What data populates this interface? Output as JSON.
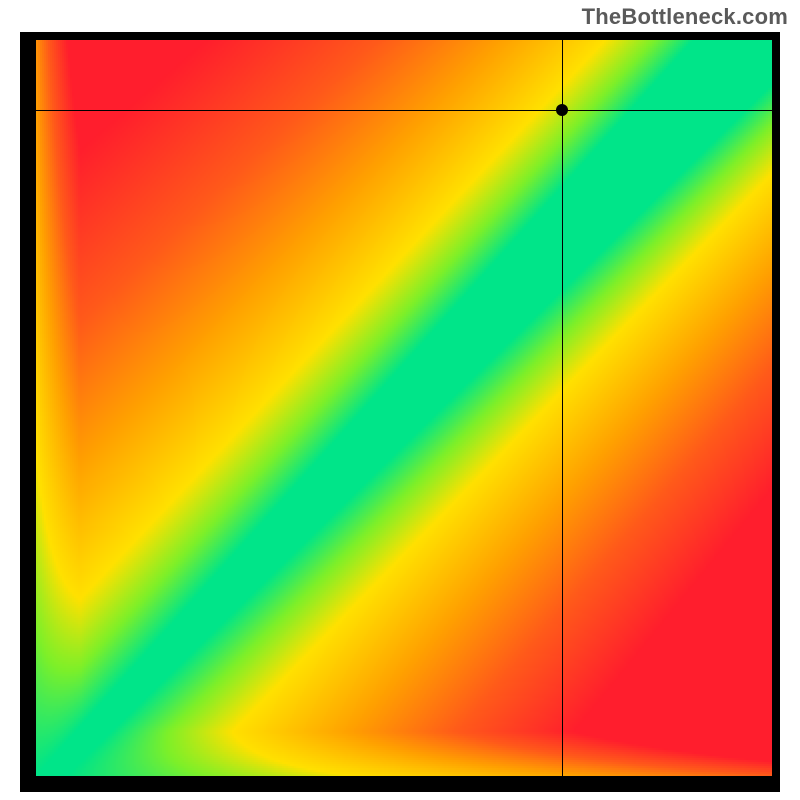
{
  "watermark": "TheBottleneck.com",
  "chart_data": {
    "type": "heatmap",
    "title": "",
    "xlabel": "",
    "ylabel": "",
    "xlim": [
      0,
      1
    ],
    "ylim": [
      0,
      1
    ],
    "grid": false,
    "legend": false,
    "description": "Bottleneck heatmap. Green diagonal band marks balanced (no-bottleneck) combinations; transition through yellow to red indicates increasing bottleneck severity. Crosshair + dot mark the currently evaluated combination.",
    "optimal_band": {
      "center_slope": 1.05,
      "center_intercept": -0.02,
      "halfwidth_low": 0.02,
      "halfwidth_high": 0.09
    },
    "marker": {
      "x": 0.715,
      "y": 0.905
    },
    "crosshair": {
      "x": 0.715,
      "y": 0.905
    },
    "color_stops": {
      "0.00": "#00e589",
      "0.10": "#7df029",
      "0.22": "#ffe100",
      "0.45": "#ffa200",
      "0.70": "#ff5a1a",
      "1.00": "#ff1e2d"
    }
  }
}
